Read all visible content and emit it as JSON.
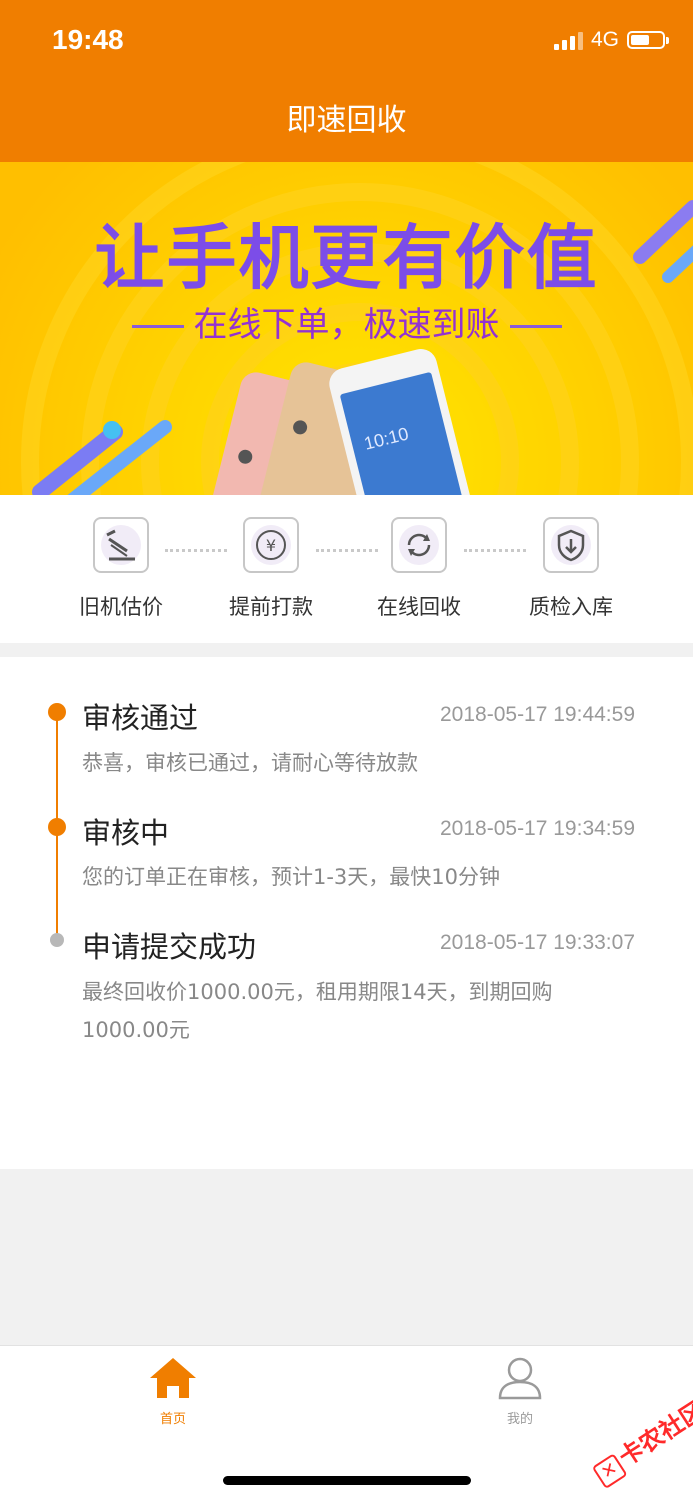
{
  "status_bar": {
    "time": "19:48",
    "network": "4G"
  },
  "nav": {
    "title": "即速回收"
  },
  "banner": {
    "title": "让手机更有价值",
    "subtitle": "在线下单，极速到账"
  },
  "steps": [
    {
      "label": "旧机估价",
      "icon": "gavel-icon"
    },
    {
      "label": "提前打款",
      "icon": "yen-icon"
    },
    {
      "label": "在线回收",
      "icon": "recycle-icon"
    },
    {
      "label": "质检入库",
      "icon": "shield-icon"
    }
  ],
  "timeline": [
    {
      "title": "审核通过",
      "time": "2018-05-17 19:44:59",
      "desc": "恭喜，审核已通过，请耐心等待放款",
      "dot_color": "#f07e00"
    },
    {
      "title": "审核中",
      "time": "2018-05-17 19:34:59",
      "desc": "您的订单正在审核，预计1-3天，最快10分钟",
      "dot_color": "#f07e00"
    },
    {
      "title": "申请提交成功",
      "time": "2018-05-17 19:33:07",
      "desc": "最终回收价1000.00元，租用期限14天，到期回购1000.00元",
      "dot_color": "#b8b8b8"
    }
  ],
  "tabbar": {
    "items": [
      {
        "label": "首页",
        "icon": "home-icon",
        "active": true
      },
      {
        "label": "我的",
        "icon": "user-icon",
        "active": false
      }
    ]
  },
  "watermark": {
    "text": "卡农社区"
  },
  "colors": {
    "accent": "#f07e00",
    "banner_bg": "#ffc800",
    "title_purple": "#7c4de8"
  }
}
